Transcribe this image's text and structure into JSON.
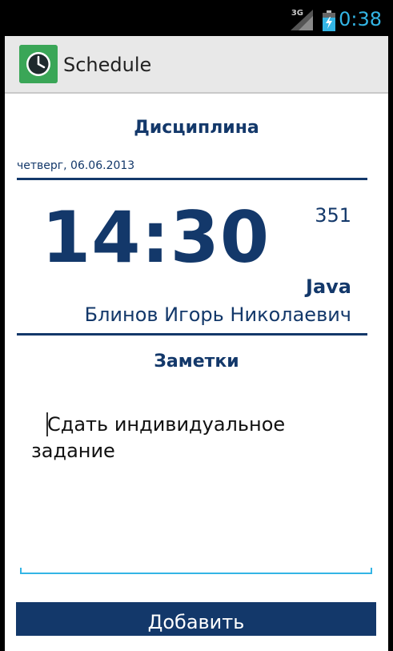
{
  "status_bar": {
    "network": "3G",
    "time": "0:38",
    "colors": {
      "clock": "#33b5e5",
      "background": "#000000"
    }
  },
  "action_bar": {
    "title": "Schedule",
    "icon": "clock-icon",
    "colors": {
      "icon_bg": "#3aa657",
      "background": "#e8e8e8"
    }
  },
  "lesson": {
    "discipline_heading": "Дисциплина",
    "date": "четверг, 06.06.2013",
    "time": "14:30",
    "room": "351",
    "subject": "Java",
    "teacher": "Блинов Игорь Николаевич"
  },
  "notes": {
    "heading": "Заметки",
    "value": "Сдать индивидуальное задание"
  },
  "actions": {
    "add_label": "Добавить"
  },
  "theme": {
    "primary": "#13386a",
    "accent": "#33b5e5"
  }
}
